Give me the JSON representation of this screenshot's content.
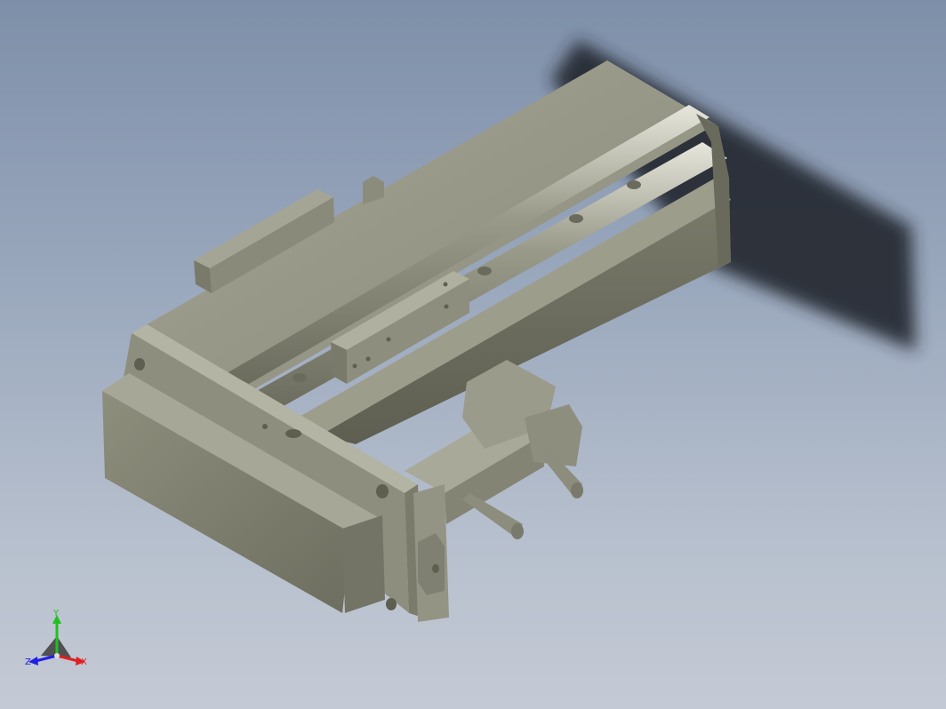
{
  "viewport": {
    "background_top": "#7e8fa9",
    "background_bottom": "#c4cad5"
  },
  "model": {
    "description_icon": "linear-actuator-3d-model",
    "body_color": "#8a8a7a",
    "shadow_color": "#23272e"
  },
  "view_cube": {
    "x_label": "X",
    "y_label": "Y",
    "z_label": "Z",
    "x_color": "#e02020",
    "y_color": "#20c020",
    "z_color": "#2020e0"
  }
}
